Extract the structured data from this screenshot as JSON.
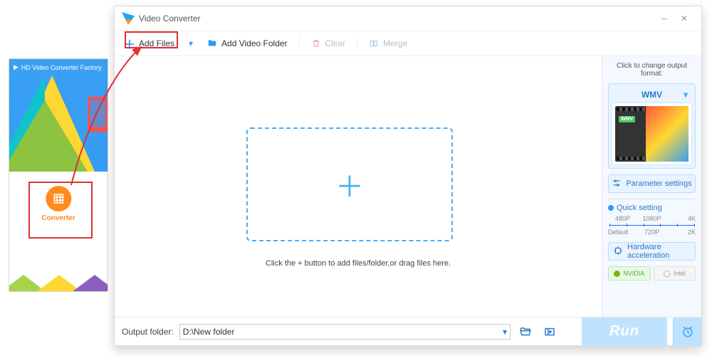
{
  "launcher": {
    "title": "HD Video Converter Factory",
    "converter_label": "Converter"
  },
  "window": {
    "title": "Video Converter"
  },
  "toolbar": {
    "add_files": "Add Files",
    "add_folder": "Add Video Folder",
    "clear": "Clear",
    "merge": "Merge"
  },
  "dropzone": {
    "hint": "Click the + button to add files/folder,or drag files here."
  },
  "side": {
    "head": "Click to change output format:",
    "format_label": "WMV",
    "wmv_badge": "WMV",
    "param_label": "Parameter settings",
    "quick_label": "Quick setting",
    "scale": {
      "t1": "480P",
      "t2": "1080P",
      "t3": "4K",
      "b1": "Default",
      "b2": "720P",
      "b3": "2K"
    },
    "hw_label": "Hardware acceleration",
    "chip_nvidia": "NVIDIA",
    "chip_intel": "Intel"
  },
  "footer": {
    "output_label": "Output folder:",
    "path": "D:\\New folder",
    "run": "Run"
  }
}
